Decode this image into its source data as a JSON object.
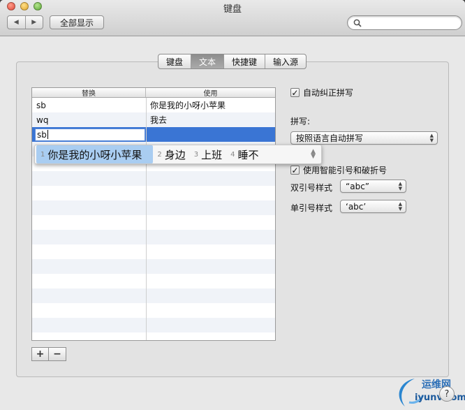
{
  "window": {
    "title": "键盘"
  },
  "toolbar": {
    "back_glyph": "◀",
    "forward_glyph": "▶",
    "show_all_label": "全部显示",
    "search_placeholder": ""
  },
  "tabs": [
    {
      "label": "键盘",
      "active": false
    },
    {
      "label": "文本",
      "active": true
    },
    {
      "label": "快捷键",
      "active": false
    },
    {
      "label": "输入源",
      "active": false
    }
  ],
  "table": {
    "headers": [
      "替换",
      "使用"
    ],
    "rows": [
      {
        "replace": "sb",
        "with": "你是我的小呀小苹果"
      },
      {
        "replace": "wq",
        "with": "我去"
      }
    ],
    "editing_row": {
      "replace": "sb",
      "with": ""
    }
  },
  "ime": {
    "candidates": [
      {
        "num": "1",
        "text": "你是我的小呀小苹果"
      },
      {
        "num": "2",
        "text": "身边"
      },
      {
        "num": "3",
        "text": "上班"
      },
      {
        "num": "4",
        "text": "睡不"
      }
    ]
  },
  "buttons": {
    "add": "+",
    "remove": "−"
  },
  "options": {
    "auto_correct": {
      "label": "自动纠正拼写",
      "checked": true
    },
    "spelling_label": "拼写:",
    "spelling_value": "按照语言自动拼写",
    "smart_quotes": {
      "label": "使用智能引号和破折号",
      "checked": true
    },
    "double_quote_label": "双引号样式",
    "double_quote_value": "“abc”",
    "single_quote_label": "单引号样式",
    "single_quote_value": "‘abc’"
  },
  "watermark": {
    "line1": "运维网",
    "line2": "iyunv.com"
  },
  "help_label": "?",
  "colors": {
    "selection": "#3a75d4",
    "candidate_highlight": "#a9cdf1",
    "tab_active": "#8d8d8d"
  },
  "icons": {
    "search": "search-icon",
    "checkbox": "checkmark-icon",
    "help": "help-icon"
  }
}
